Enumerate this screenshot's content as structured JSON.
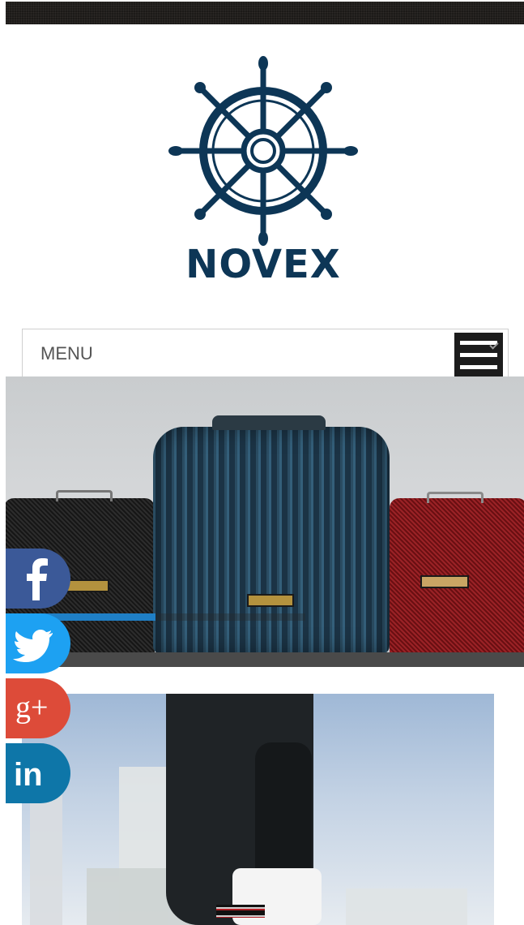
{
  "brand": {
    "name": "NOVEX",
    "colors": {
      "primary": "#0d3656",
      "topbar": "#1c1a18"
    },
    "logo_icon": "ship-wheel-icon"
  },
  "nav": {
    "menu_label": "MENU",
    "toggle_icon": "hamburger-menu-icon"
  },
  "hero_slider": {
    "image": "three-suitcases-black-blue-red",
    "progress": 0.5,
    "progress_color": "#1f7fc6"
  },
  "content": {
    "image": "person-in-black-bomber-jacket-city-skyline"
  },
  "social_links": [
    {
      "id": "facebook",
      "label": "f",
      "icon": "facebook-icon",
      "color": "#3b5998"
    },
    {
      "id": "twitter",
      "label": "",
      "icon": "twitter-bird-icon",
      "color": "#1da1f2"
    },
    {
      "id": "google-plus",
      "label": "g+",
      "icon": "google-plus-icon",
      "color": "#dd4b39"
    },
    {
      "id": "linkedin",
      "label": "in",
      "icon": "linkedin-icon",
      "color": "#0e76a8"
    }
  ]
}
